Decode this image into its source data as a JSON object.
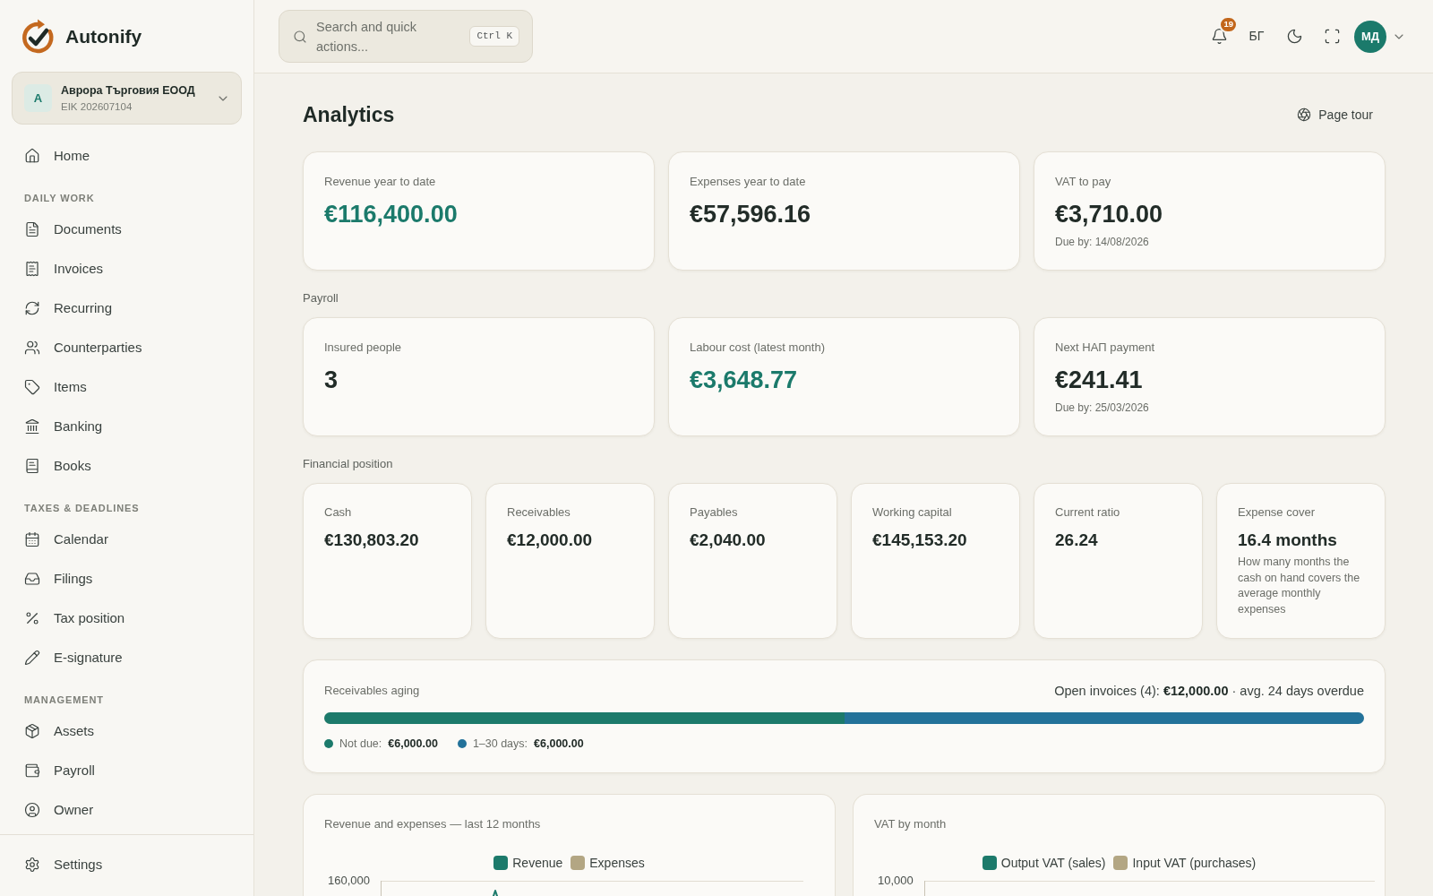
{
  "sidebar": {
    "brand": "Autonify",
    "company": {
      "initial": "A",
      "name": "Аврора Търговия ЕООД",
      "id_label": "EIK 202607104"
    },
    "sections": [
      {
        "items": [
          {
            "label": "Home",
            "selected": false
          }
        ]
      },
      {
        "heading": "DAILY WORK",
        "items": [
          {
            "label": "Documents",
            "selected": false
          },
          {
            "label": "Invoices",
            "selected": false
          },
          {
            "label": "Recurring",
            "selected": false
          },
          {
            "label": "Counterparties",
            "selected": false
          },
          {
            "label": "Items",
            "selected": false
          },
          {
            "label": "Banking",
            "selected": false
          },
          {
            "label": "Books",
            "selected": false
          }
        ]
      },
      {
        "heading": "TAXES & DEADLINES",
        "items": [
          {
            "label": "Calendar",
            "selected": false
          },
          {
            "label": "Filings",
            "selected": false
          },
          {
            "label": "Tax position",
            "selected": false
          },
          {
            "label": "E-signature",
            "selected": false
          }
        ]
      },
      {
        "heading": "MANAGEMENT",
        "items": [
          {
            "label": "Assets",
            "selected": false
          },
          {
            "label": "Payroll",
            "selected": false
          },
          {
            "label": "Owner",
            "selected": false
          }
        ]
      }
    ],
    "footer_items": [
      {
        "label": "Settings",
        "selected": false
      }
    ]
  },
  "header": {
    "search": {
      "placeholder": "Search and quick actions...",
      "shortcut": "Ctrl K"
    },
    "notification_count": "19",
    "language": "БГ",
    "user_initials": "МД"
  },
  "page": {
    "title": "Analytics",
    "tour_button": "Page tour"
  },
  "summary_cards": [
    {
      "label": "Revenue year to date",
      "value": "€116,400.00",
      "accent": true
    },
    {
      "label": "Expenses year to date",
      "value": "€57,596.16",
      "accent": false
    },
    {
      "label": "VAT to pay",
      "value": "€3,710.00",
      "accent": false,
      "note": "Due by: 14/08/2026"
    }
  ],
  "payroll": {
    "heading": "Payroll",
    "cards": [
      {
        "label": "Insured people",
        "value": "3",
        "accent": false
      },
      {
        "label": "Labour cost (latest month)",
        "value": "€3,648.77",
        "accent": true
      },
      {
        "label": "Next НАП payment",
        "value": "€241.41",
        "accent": false,
        "note": "Due by: 25/03/2026"
      }
    ]
  },
  "financial_position": {
    "heading": "Financial position",
    "cards": [
      {
        "label": "Cash",
        "value": "€130,803.20"
      },
      {
        "label": "Receivables",
        "value": "€12,000.00"
      },
      {
        "label": "Payables",
        "value": "€2,040.00"
      },
      {
        "label": "Working capital",
        "value": "€145,153.20"
      },
      {
        "label": "Current ratio",
        "value": "26.24"
      },
      {
        "label": "Expense cover",
        "value": "16.4 months",
        "note": "How many months the cash on hand covers the average monthly expenses"
      }
    ]
  },
  "receivables_aging": {
    "title": "Receivables aging",
    "summary": "Open invoices (4): **€12,000.00** · avg. 24 days overdue",
    "segments": [
      {
        "label": "Not due:",
        "amount": "€6,000.00",
        "color": "#1c7a6b",
        "level": 0.5
      },
      {
        "label": "1–30 days:",
        "amount": "€6,000.00",
        "color": "#23729a",
        "level": 0.5
      }
    ]
  },
  "charts": [
    {
      "title": "Revenue and expenses — last 12 months",
      "legend": [
        {
          "label": "Revenue",
          "color": "#1c7a6b"
        },
        {
          "label": "Expenses",
          "color": "#b3a683"
        }
      ],
      "y_tick_label": "160,000"
    },
    {
      "title": "VAT by month",
      "legend": [
        {
          "label": "Output VAT (sales)",
          "color": "#1c7a6b"
        },
        {
          "label": "Input VAT (purchases)",
          "color": "#b3a683"
        }
      ],
      "y_tick_label": "10,000"
    }
  ]
}
